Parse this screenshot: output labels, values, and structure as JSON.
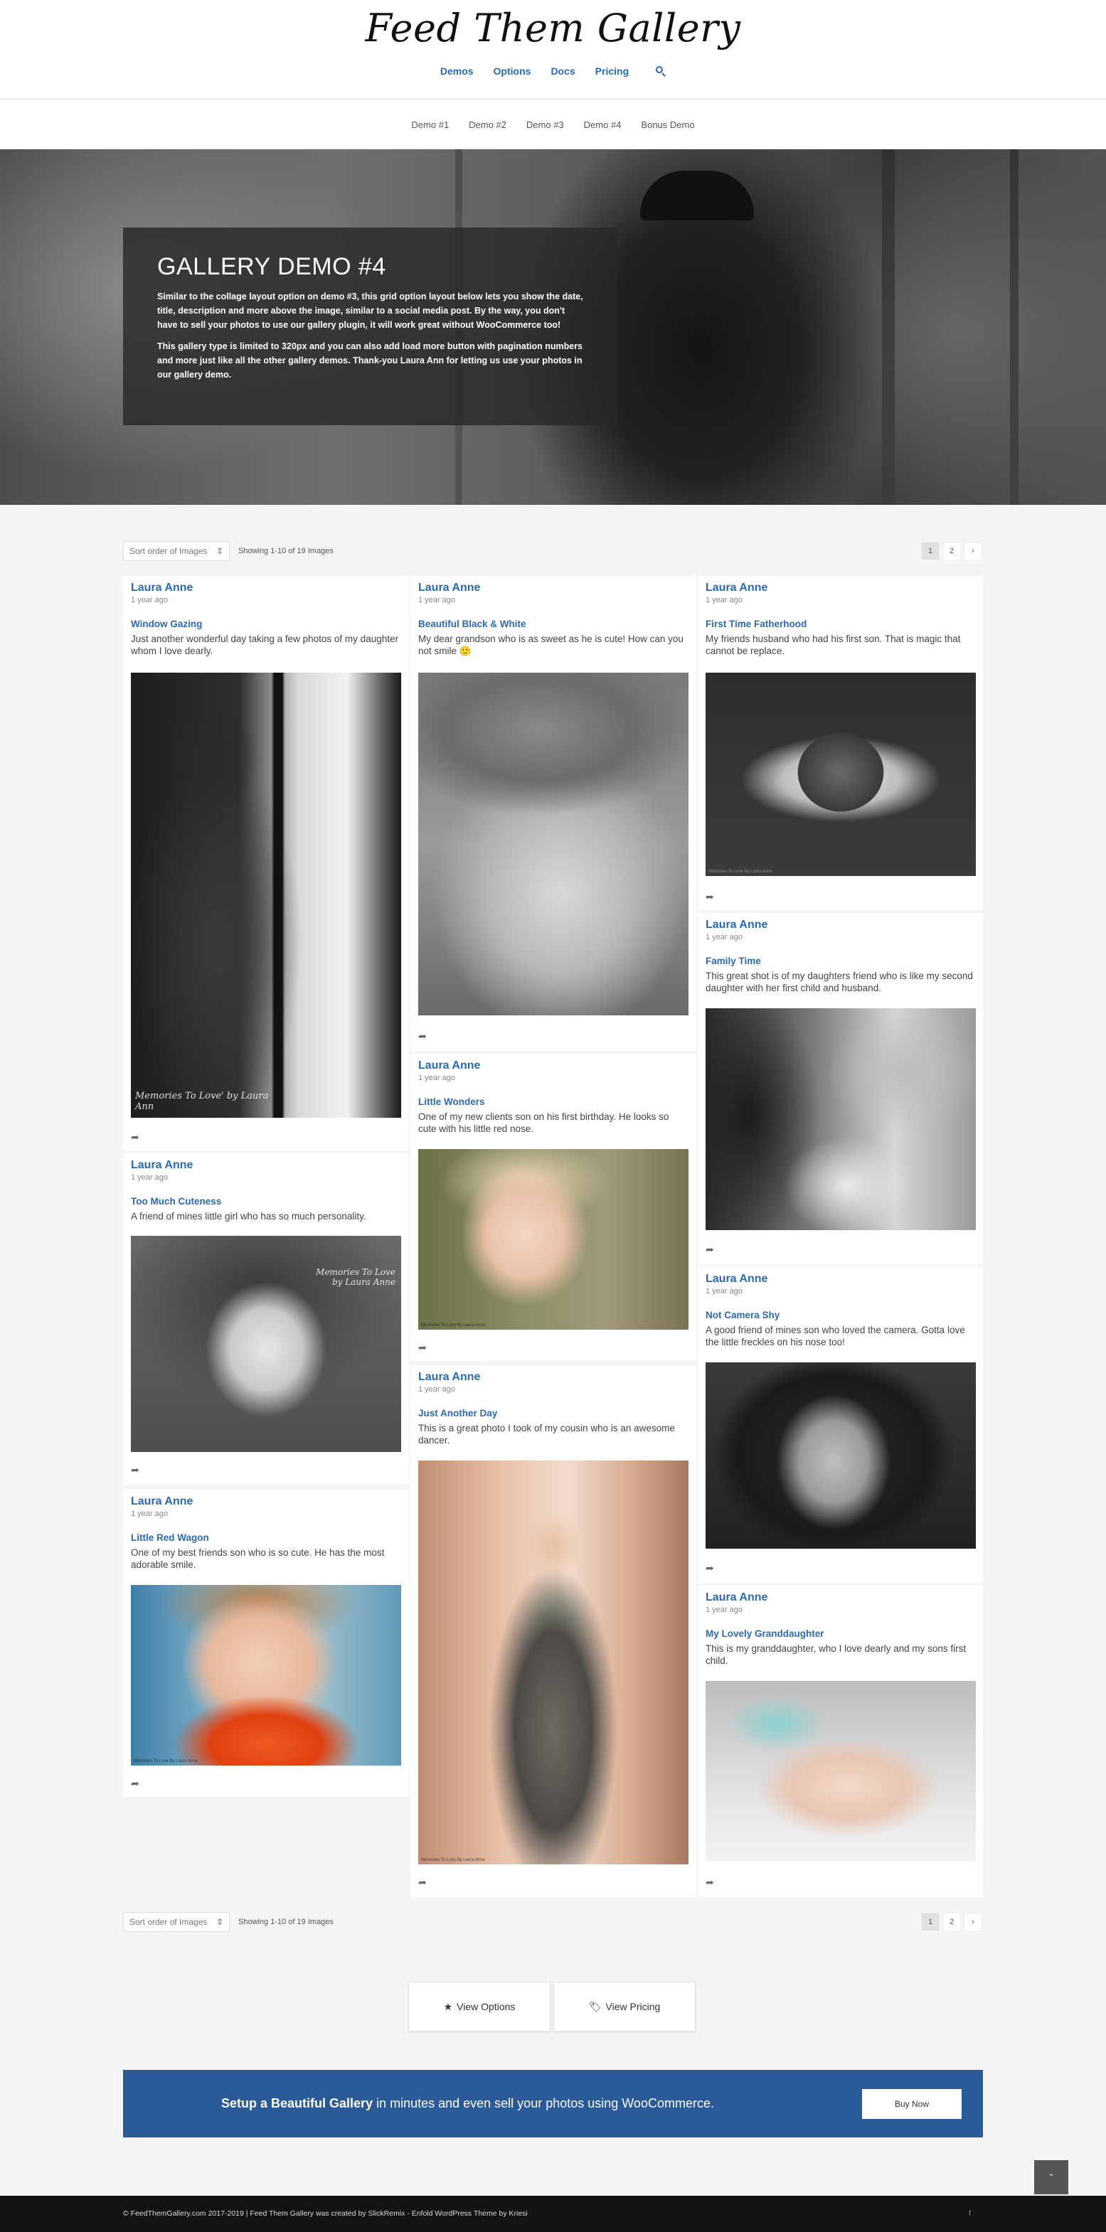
{
  "site": {
    "logo": "Feed Them Gallery"
  },
  "main_nav": [
    "Demos",
    "Options",
    "Docs",
    "Pricing"
  ],
  "sub_nav": [
    "Demo #1",
    "Demo #2",
    "Demo #3",
    "Demo #4",
    "Bonus Demo"
  ],
  "hero": {
    "title": "GALLERY DEMO #4",
    "paragraph_1": "Similar to the collage layout option on demo #3, this grid option layout below lets you show the date, title, description and more above the image, similar to a social media post. By the way, you don't have to sell your photos to use our gallery plugin, it will work great without WooCommerce too!",
    "paragraph_2": "This gallery type is limited to 320px and you can also add load more button with pagination numbers and more just like all the other gallery demos. Thank-you Laura Ann for letting us use your photos in our gallery demo."
  },
  "controls": {
    "sort_label": "Sort order of Images",
    "showing": "Showing 1-10 of 19 Images",
    "pages": [
      "1",
      "2",
      "›"
    ]
  },
  "posts": [
    {
      "author": "Laura Anne",
      "date": "1 year ago",
      "title": "Window Gazing",
      "description": "Just another wonderful day taking a few photos of my daughter whom I love dearly.",
      "watermark": "Memories To Love' by Laura Ann"
    },
    {
      "author": "Laura Anne",
      "date": "1 year ago",
      "title": "Too Much Cuteness",
      "description": "A friend of mines little girl who has so much personality.",
      "watermark": "Memories To Love by Laura Anne"
    },
    {
      "author": "Laura Anne",
      "date": "1 year ago",
      "title": "Little Red Wagon",
      "description": "One of my best friends son who is so cute. He has the most adorable smile.",
      "watermark": "Memories To Love By Laura Anne"
    },
    {
      "author": "Laura Anne",
      "date": "1 year ago",
      "title": "Beautiful Black & White",
      "description": "My dear grandson who is as sweet as he is cute! How can you not smile 🙂",
      "watermark": ""
    },
    {
      "author": "Laura Anne",
      "date": "1 year ago",
      "title": "Little Wonders",
      "description": "One of my new clients son on his first birthday. He looks so cute with his little red nose.",
      "watermark": "Memories To Love By Laura Anne"
    },
    {
      "author": "Laura Anne",
      "date": "1 year ago",
      "title": "Just Another Day",
      "description": "This is a great photo I took of my cousin who is an awesome dancer.",
      "watermark": "Memories To Love By Laura Anne"
    },
    {
      "author": "Laura Anne",
      "date": "1 year ago",
      "title": "First Time Fatherhood",
      "description": "My friends husband who had his first son. That is magic that cannot be replace.",
      "watermark": "Memories To Love By Laura Anne"
    },
    {
      "author": "Laura Anne",
      "date": "1 year ago",
      "title": "Family Time",
      "description": "This great shot is of my daughters friend who is like my second daughter with her first child and husband.",
      "watermark": ""
    },
    {
      "author": "Laura Anne",
      "date": "1 year ago",
      "title": "Not Camera Shy",
      "description": "A good friend of mines son who loved the camera. Gotta love the little freckles on his nose too!",
      "watermark": ""
    },
    {
      "author": "Laura Anne",
      "date": "1 year ago",
      "title": "My Lovely Granddaughter",
      "description": "This is my granddaughter, who I love dearly and my sons first child.",
      "watermark": ""
    }
  ],
  "buttons": {
    "view_options": "View Options",
    "view_pricing": "View Pricing"
  },
  "cta": {
    "bold": "Setup a Beautiful Gallery",
    "rest": " in minutes and even sell your photos using WooCommerce.",
    "button": "Buy Now"
  },
  "scroll_top": "⌃",
  "footer": {
    "text": "© FeedThemGallery.com 2017-2019 | Feed Them Gallery was created by SlickRemix - Enfold WordPress Theme by Kriesi",
    "social": "f"
  },
  "colors": {
    "link": "#2a6ab3",
    "cta_bg": "#2a5b98",
    "footer_bg": "#121212"
  },
  "icons": [
    "search-icon",
    "share-icon",
    "star-icon",
    "tag-icon",
    "chevron-up-icon",
    "facebook-icon"
  ]
}
